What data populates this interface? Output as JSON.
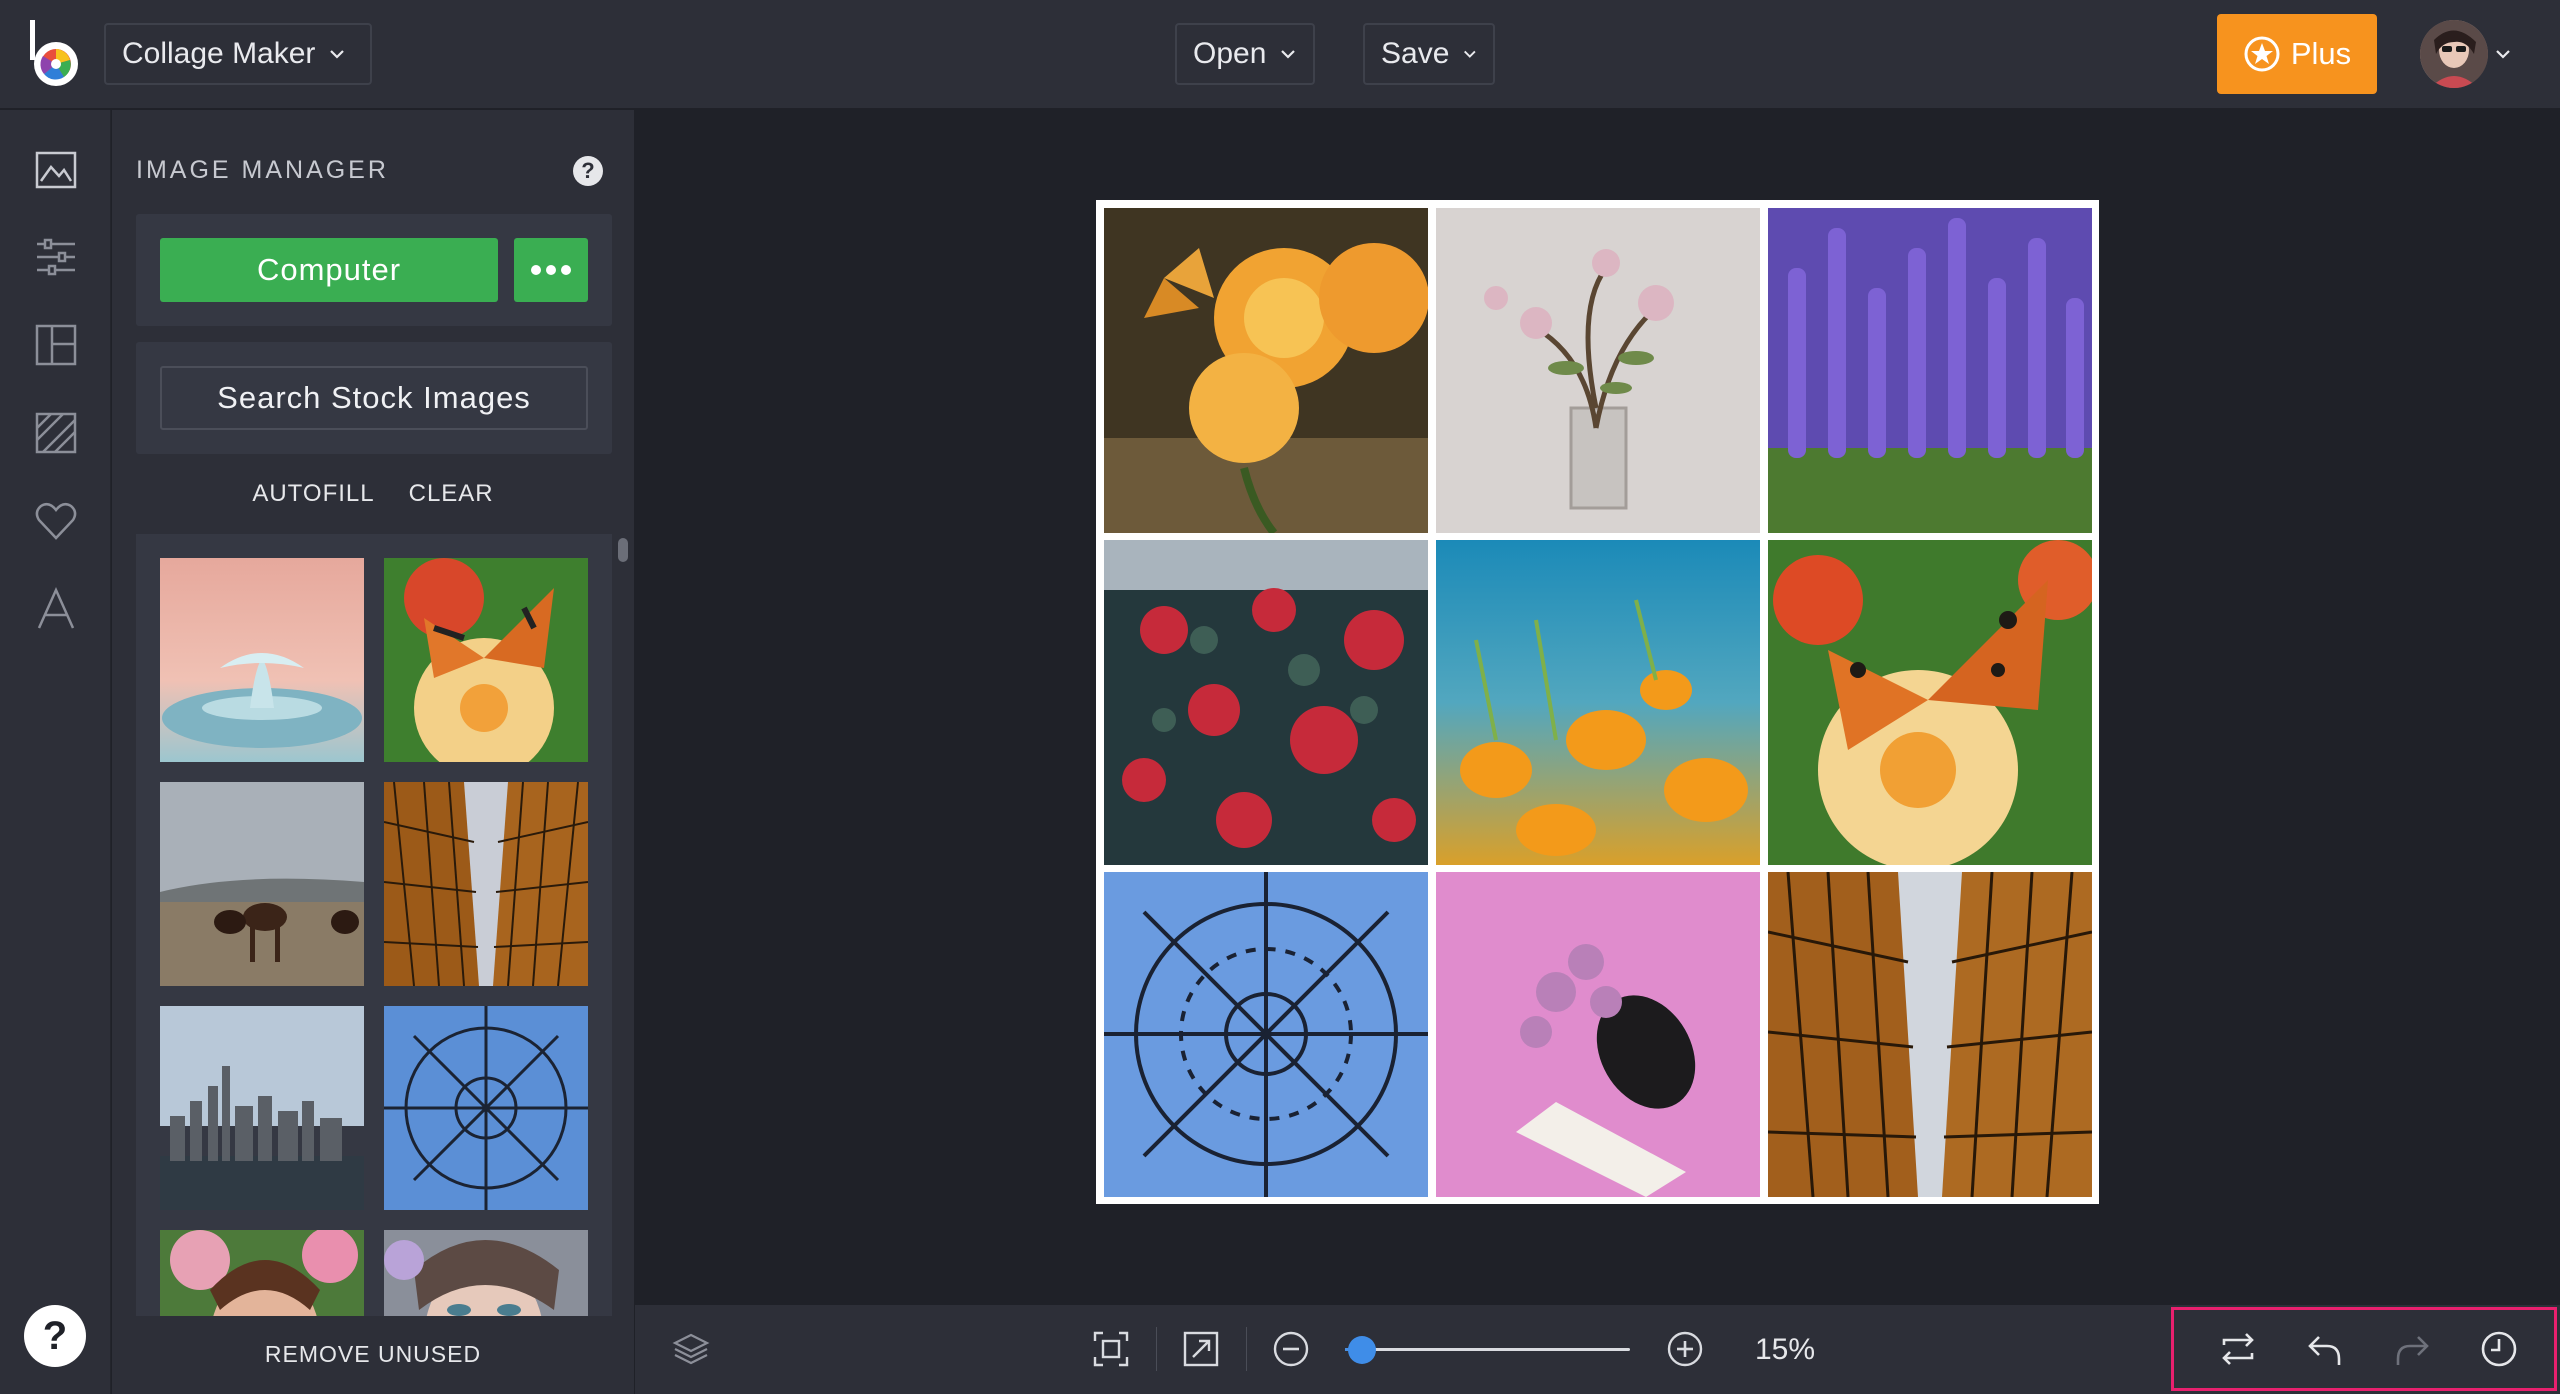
{
  "app": {
    "mode_label": "Collage Maker",
    "open_label": "Open",
    "save_label": "Save",
    "plus_label": "Plus"
  },
  "rail": {
    "items": [
      "image-icon",
      "sliders-icon",
      "layout-icon",
      "background-icon",
      "heart-icon",
      "text-icon"
    ],
    "help_label": "?"
  },
  "panel": {
    "title": "IMAGE MANAGER",
    "help_label": "?",
    "computer_label": "Computer",
    "stock_label": "Search Stock Images",
    "autofill_label": "AUTOFILL",
    "clear_label": "CLEAR",
    "remove_unused_label": "REMOVE UNUSED"
  },
  "toolbar": {
    "zoom_label": "15%",
    "zoom_fraction": 0.06
  },
  "colors": {
    "accent_orange": "#f7931e",
    "accent_green": "#3aae52",
    "accent_blue": "#3f8de8",
    "highlight": "#e8206e"
  }
}
